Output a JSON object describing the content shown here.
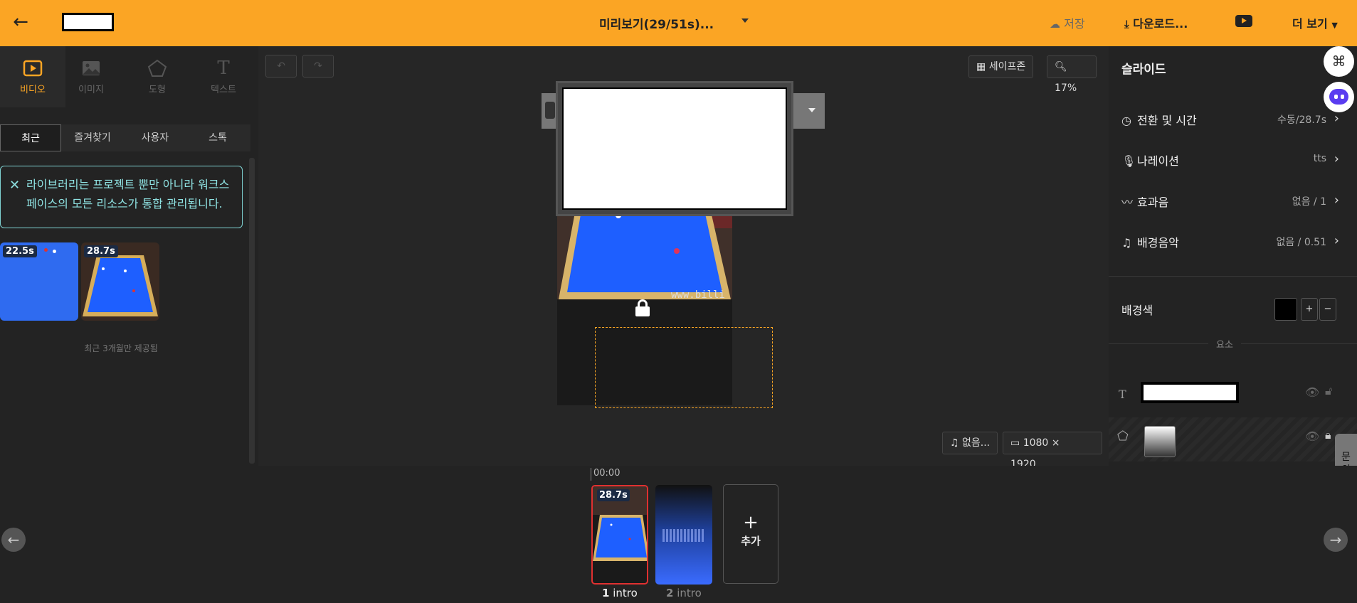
{
  "header": {
    "title": "미리보기(29/51s)...",
    "save_label": "저장",
    "download_label": "다운로드...",
    "more_label": "더 보기"
  },
  "left_panel": {
    "tabs": [
      {
        "label": "비디오",
        "icon": "video-play-icon",
        "active": true
      },
      {
        "label": "이미지",
        "icon": "image-icon",
        "active": false
      },
      {
        "label": "도형",
        "icon": "pentagon-icon",
        "active": false
      },
      {
        "label": "텍스트",
        "icon": "text-t-icon",
        "active": false
      }
    ],
    "subtabs": [
      "최근",
      "즐겨찾기",
      "사용자",
      "스톡"
    ],
    "notice": "라이브러리는 프로젝트 뿐만 아니라 워크스페이스의 모든 리소스가 통합 관리됩니다.",
    "thumbs": [
      {
        "duration": "22.5s"
      },
      {
        "duration": "28.7s"
      }
    ],
    "recent_note": "최근 3개월만 제공됨"
  },
  "canvas": {
    "safezone_label": "세이프존",
    "zoom_label": "17%",
    "watermark": "www.billi",
    "music_label": "없음...",
    "resolution_label": "1080 × 1920..."
  },
  "right_panel": {
    "title": "슬라이드",
    "rows": [
      {
        "label": "전환 및 시간",
        "value": "수동/28.7s",
        "icon": "clock-icon"
      },
      {
        "label": "나레이션",
        "value": "tts",
        "icon": "microphone-icon"
      },
      {
        "label": "효과음",
        "value": "없음 / 1",
        "icon": "sound-wave-icon"
      },
      {
        "label": "배경음악",
        "value": "없음 / 0.51",
        "icon": "music-note-icon"
      }
    ],
    "bg_label": "배경색",
    "bg_color": "#000000",
    "elements_label": "요소",
    "inquiry_label": "문의"
  },
  "timeline": {
    "timecode": "00:00",
    "slides": [
      {
        "index": "1",
        "name": "intro",
        "duration": "28.7s"
      },
      {
        "index": "2",
        "name": "intro"
      }
    ],
    "add_label": "추가"
  }
}
